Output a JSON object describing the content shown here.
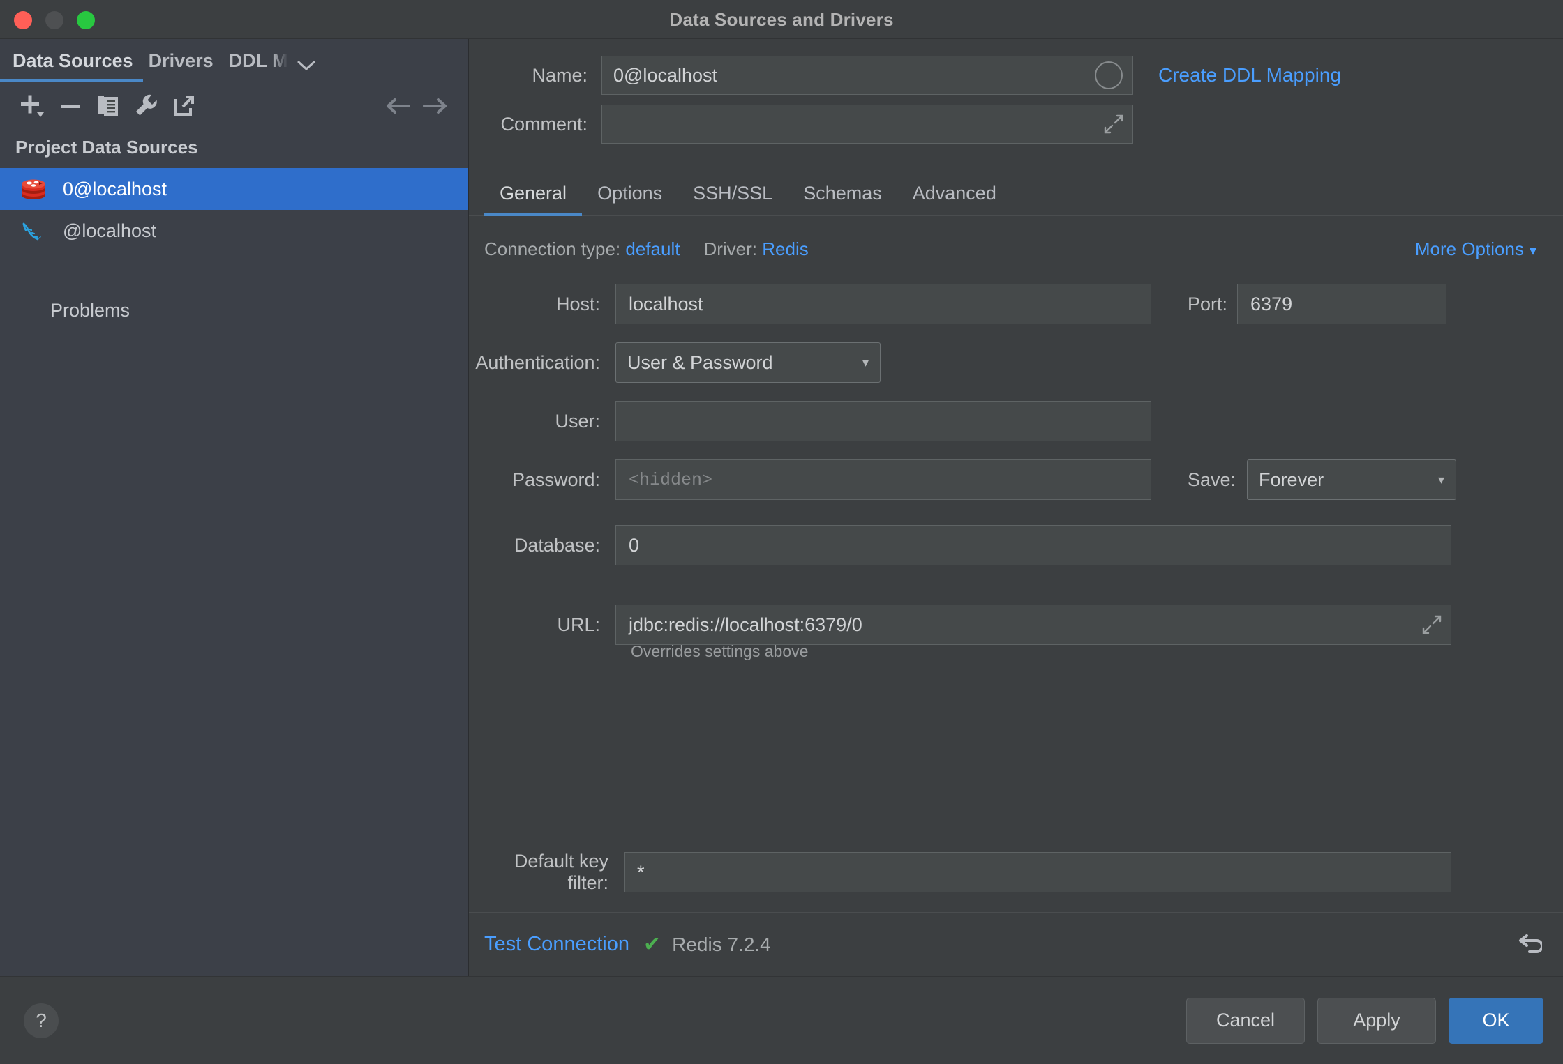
{
  "window": {
    "title": "Data Sources and Drivers",
    "traffic_lights": [
      "close-red",
      "minimize-grey",
      "zoom-green"
    ]
  },
  "sidebar": {
    "tabs": [
      {
        "label": "Data Sources",
        "active": true
      },
      {
        "label": "Drivers",
        "active": false
      },
      {
        "label": "DDL M",
        "active": false,
        "truncated": true
      }
    ],
    "tabs_overflow_icon": "chevron-down-icon",
    "toolbar": [
      {
        "icon": "add-icon",
        "label": "Add"
      },
      {
        "icon": "remove-icon",
        "label": "Remove"
      },
      {
        "icon": "copy-icon",
        "label": "Duplicate"
      },
      {
        "icon": "wrench-icon",
        "label": "Properties"
      },
      {
        "icon": "export-icon",
        "label": "Share"
      }
    ],
    "nav": [
      {
        "icon": "arrow-left-icon",
        "label": "Back"
      },
      {
        "icon": "arrow-right-icon",
        "label": "Forward"
      }
    ],
    "section_title": "Project Data Sources",
    "data_sources": [
      {
        "name": "0@localhost",
        "icon": "redis-icon",
        "selected": true
      },
      {
        "name": "@localhost",
        "icon": "mysql-icon",
        "selected": false
      }
    ],
    "problems_label": "Problems"
  },
  "form": {
    "name_label": "Name:",
    "name_value": "0@localhost",
    "color_picker_icon": "color-circle-icon",
    "comment_label": "Comment:",
    "comment_value": "",
    "comment_expand_icon": "expand-icon",
    "ddl_mapping_link": "Create DDL Mapping"
  },
  "tabs": [
    {
      "label": "General",
      "active": true
    },
    {
      "label": "Options",
      "active": false
    },
    {
      "label": "SSH/SSL",
      "active": false
    },
    {
      "label": "Schemas",
      "active": false
    },
    {
      "label": "Advanced",
      "active": false
    }
  ],
  "general": {
    "connection_type_label": "Connection type:",
    "connection_type_value": "default",
    "driver_label": "Driver:",
    "driver_value": "Redis",
    "more_options": "More Options",
    "more_options_icon": "chevron-down-icon",
    "host_label": "Host:",
    "host_value": "localhost",
    "port_label": "Port:",
    "port_value": "6379",
    "auth_label": "Authentication:",
    "auth_value": "User & Password",
    "user_label": "User:",
    "user_value": "",
    "password_label": "Password:",
    "password_placeholder": "<hidden>",
    "save_label": "Save:",
    "save_value": "Forever",
    "database_label": "Database:",
    "database_value": "0",
    "url_label": "URL:",
    "url_value": "jdbc:redis://localhost:6379/0",
    "url_expand_icon": "expand-icon",
    "url_hint": "Overrides settings above",
    "key_filter_label": "Default key filter:",
    "key_filter_value": "*"
  },
  "test_bar": {
    "test_connection": "Test Connection",
    "status_icon": "check-icon",
    "version": "Redis 7.2.4",
    "revert_icon": "revert-icon"
  },
  "footer": {
    "help_icon": "help-icon",
    "cancel": "Cancel",
    "apply": "Apply",
    "ok": "OK"
  },
  "colors": {
    "accent_blue": "#4a9eff",
    "selection_blue": "#2f6ecb",
    "primary_button": "#3574b8",
    "success_green": "#4caf50",
    "redis_red": "#d82c20",
    "mysql_blue": "#2ba3e0"
  }
}
